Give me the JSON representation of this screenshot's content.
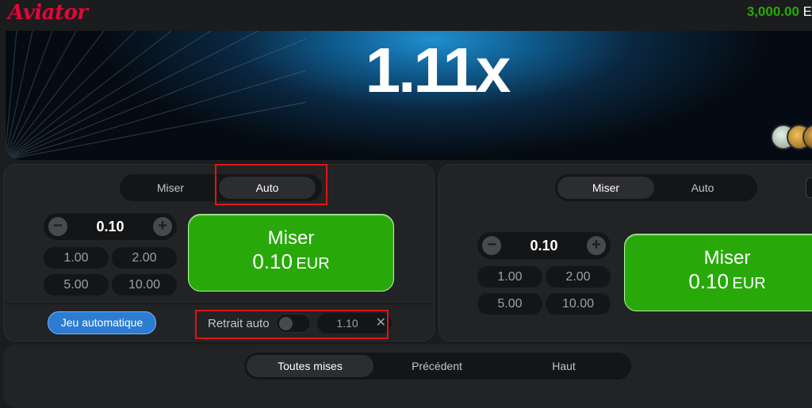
{
  "header": {
    "logo_text": "Aviator",
    "balance": "3,000.00",
    "balance_currency_partial": "E",
    "colors": {
      "logo": "#e50539",
      "balance": "#28a909"
    }
  },
  "stage": {
    "multiplier": "1.11x",
    "players_avatars": [
      "avatar-1",
      "avatar-2",
      "avatar-3"
    ]
  },
  "bet_panels": [
    {
      "tabs": [
        {
          "label": "Miser",
          "active": false
        },
        {
          "label": "Auto",
          "active": true
        }
      ],
      "stake_value": "0.10",
      "decrement_icon": "minus-icon",
      "increment_icon": "plus-icon",
      "quick_amounts": [
        "1.00",
        "2.00",
        "5.00",
        "10.00"
      ],
      "bet_button": {
        "label": "Miser",
        "amount": "0.10",
        "currency": "EUR"
      },
      "auto_play_label": "Jeu automatique",
      "auto_cashout": {
        "label": "Retrait auto",
        "enabled": false,
        "value": "1.10",
        "clear_icon": "close-icon"
      }
    },
    {
      "tabs": [
        {
          "label": "Miser",
          "active": true
        },
        {
          "label": "Auto",
          "active": false
        }
      ],
      "stake_value": "0.10",
      "decrement_icon": "minus-icon",
      "increment_icon": "plus-icon",
      "quick_amounts": [
        "1.00",
        "2.00",
        "5.00",
        "10.00"
      ],
      "bet_button": {
        "label": "Miser",
        "amount": "0.10",
        "currency": "EUR"
      }
    }
  ],
  "history": {
    "tabs": [
      {
        "label": "Toutes mises",
        "active": true
      },
      {
        "label": "Précédent",
        "active": false
      },
      {
        "label": "Haut",
        "active": false
      }
    ]
  },
  "colors": {
    "bet_green": "#28a909",
    "auto_blue": "#2c7cd1",
    "highlight_red": "#e11414"
  }
}
